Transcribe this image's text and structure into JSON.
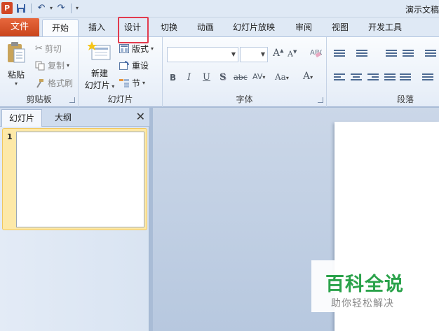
{
  "window": {
    "app_badge": "P",
    "title": "演示文稿"
  },
  "tabs": {
    "file": "文件",
    "items": [
      "开始",
      "插入",
      "设计",
      "切换",
      "动画",
      "幻灯片放映",
      "审阅",
      "视图",
      "开发工具"
    ],
    "active": "开始",
    "highlighted": "设计"
  },
  "ribbon": {
    "clipboard": {
      "label": "剪贴板",
      "paste": "粘贴",
      "cut": "剪切",
      "copy": "复制",
      "format_painter": "格式刷"
    },
    "slides": {
      "label": "幻灯片",
      "new_slide_line1": "新建",
      "new_slide_line2": "幻灯片",
      "layout": "版式",
      "reset": "重设",
      "section": "节"
    },
    "font": {
      "label": "字体",
      "bold": "B",
      "italic": "I",
      "underline": "U",
      "shadow": "S",
      "strike": "abc",
      "spacing": "AV",
      "case": "Aa",
      "grow": "A",
      "shrink": "A",
      "color": "A"
    },
    "paragraph": {
      "label": "段落"
    }
  },
  "pane": {
    "tab_slides": "幻灯片",
    "tab_outline": "大纲",
    "close": "✕",
    "slide_number": "1"
  },
  "watermark": {
    "title": "百科全说",
    "subtitle": "助你轻松解决"
  },
  "colors": {
    "file_tab": "#d24726",
    "highlight": "#e23b4e",
    "watermark_green": "#2aa24a"
  }
}
